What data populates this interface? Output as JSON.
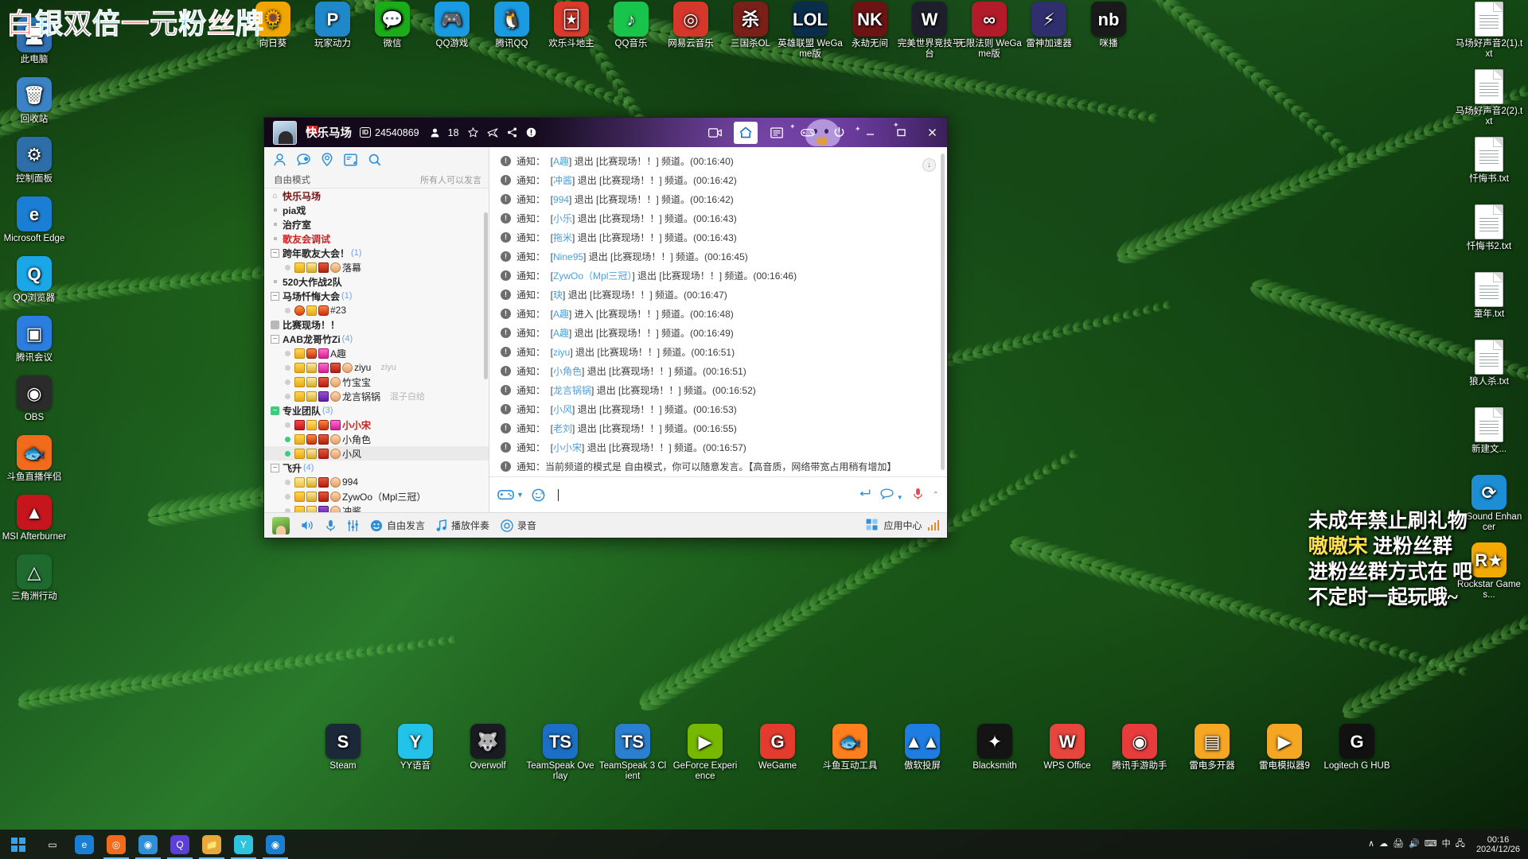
{
  "desktop": {
    "banner_text": [
      {
        "t": "白",
        "c": "#e8312a"
      },
      {
        "t": "银",
        "c": "#1fb3d6"
      },
      {
        "t": "双",
        "c": "#111111"
      },
      {
        "t": "倍",
        "c": "#1fb3d6"
      },
      {
        "t": "一",
        "c": "#e8312a"
      },
      {
        "t": "元",
        "c": "#111111"
      },
      {
        "t": "粉",
        "c": "#1fb3d6"
      },
      {
        "t": "丝",
        "c": "#e8312a"
      },
      {
        "t": "牌",
        "c": "#1fb3d6"
      }
    ],
    "watermark": [
      "未成年禁止刷礼物",
      "进粉丝群",
      "进粉丝群方式在 吧",
      "不定时一起玩哦~"
    ],
    "watermark_badge": "嗷嗷宋",
    "left_icons": [
      {
        "label": "此电脑",
        "icon": "computer-icon",
        "glyph": "🖥",
        "bg": "#2f6fb3"
      },
      {
        "label": "回收站",
        "icon": "recycle-bin-icon",
        "glyph": "🗑",
        "bg": "#3b82c4"
      },
      {
        "label": "控制面板",
        "icon": "control-panel-icon",
        "glyph": "⚙",
        "bg": "#2d6ea8"
      },
      {
        "label": "Microsoft Edge",
        "icon": "edge-icon",
        "glyph": "e",
        "bg": "#1a7fd4"
      },
      {
        "label": "QQ浏览器",
        "icon": "qq-browser-icon",
        "glyph": "Q",
        "bg": "#1aa7e8"
      },
      {
        "label": "腾讯会议",
        "icon": "tencent-meeting-icon",
        "glyph": "▣",
        "bg": "#2b7de0"
      },
      {
        "label": "OBS",
        "icon": "obs-icon",
        "glyph": "◉",
        "bg": "#2b2b2b"
      },
      {
        "label": "斗鱼直播伴侣",
        "icon": "douyu-companion-icon",
        "glyph": "🐟",
        "bg": "#f26a1b"
      },
      {
        "label": "MSI Afterburner",
        "icon": "msi-afterburner-icon",
        "glyph": "▲",
        "bg": "#c4161c"
      },
      {
        "label": "三角洲行动",
        "icon": "delta-force-icon",
        "glyph": "△",
        "bg": "#1f6b2f"
      }
    ],
    "top_icons": [
      {
        "label": "向日葵",
        "icon": "sunflower-icon",
        "glyph": "🌻",
        "bg": "#f0a500"
      },
      {
        "label": "玩家动力",
        "icon": "player-power-icon",
        "glyph": "P",
        "bg": "#1e88c8"
      },
      {
        "label": "微信",
        "icon": "wechat-icon",
        "glyph": "💬",
        "bg": "#1aad19"
      },
      {
        "label": "QQ游戏",
        "icon": "qq-games-icon",
        "glyph": "🎮",
        "bg": "#1a9ae0"
      },
      {
        "label": "腾讯QQ",
        "icon": "tencent-qq-icon",
        "glyph": "🐧",
        "bg": "#1a9ae0"
      },
      {
        "label": "欢乐斗地主",
        "icon": "ddz-icon",
        "glyph": "🃏",
        "bg": "#d93a2b"
      },
      {
        "label": "QQ音乐",
        "icon": "qq-music-icon",
        "glyph": "♪",
        "bg": "#18c44c"
      },
      {
        "label": "网易云音乐",
        "icon": "netease-music-icon",
        "glyph": "◎",
        "bg": "#d6372b"
      },
      {
        "label": "三国杀OL",
        "icon": "sgs-icon",
        "glyph": "杀",
        "bg": "#7a2018"
      },
      {
        "label": "英雄联盟 WeGame版",
        "icon": "lol-wegame-icon",
        "glyph": "LOL",
        "bg": "#0a2e4a"
      },
      {
        "label": "永劫无间",
        "icon": "naraka-icon",
        "glyph": "NK",
        "bg": "#6b1414"
      },
      {
        "label": "完美世界竞技平台",
        "icon": "perfect-world-icon",
        "glyph": "W",
        "bg": "#1e1e2c"
      },
      {
        "label": "无限法则 WeGame版",
        "icon": "ring-of-elysium-icon",
        "glyph": "∞",
        "bg": "#b21b2a"
      },
      {
        "label": "雷神加速器",
        "icon": "leishen-booster-icon",
        "glyph": "⚡",
        "bg": "#2f2f6e"
      },
      {
        "label": "咪播",
        "icon": "mibo-icon",
        "glyph": "nb",
        "bg": "#1a1a1a"
      }
    ],
    "right_icons": [
      {
        "label": "马场好声音2(1).txt",
        "icon": "text-file-icon"
      },
      {
        "label": "马场好声音2(2).txt",
        "icon": "text-file-icon"
      },
      {
        "label": "忏悔书.txt",
        "icon": "text-file-icon"
      },
      {
        "label": "忏悔书2.txt",
        "icon": "text-file-icon"
      },
      {
        "label": "童年.txt",
        "icon": "text-file-icon"
      },
      {
        "label": "狼人杀.txt",
        "icon": "text-file-icon"
      },
      {
        "label": "新建文...",
        "icon": "text-file-icon"
      },
      {
        "label": "FxSound Enhancer",
        "icon": "fxsound-icon",
        "glyph": "⟳",
        "bg": "#1b8ed6"
      },
      {
        "label": "Rockstar Games...",
        "icon": "rockstar-games-icon",
        "glyph": "R★",
        "bg": "#f2a900"
      }
    ],
    "dock_icons": [
      {
        "label": "Steam",
        "icon": "steam-icon",
        "glyph": "S",
        "bg": "#1b2838"
      },
      {
        "label": "YY语音",
        "icon": "yy-voice-icon",
        "glyph": "Y",
        "bg": "#23c2e8"
      },
      {
        "label": "Overwolf",
        "icon": "overwolf-icon",
        "glyph": "🐺",
        "bg": "#1a1a22"
      },
      {
        "label": "TeamSpeak Overlay",
        "icon": "teamspeak-overlay-icon",
        "glyph": "TS",
        "bg": "#1b6fc4"
      },
      {
        "label": "TeamSpeak 3 Client",
        "icon": "teamspeak3-icon",
        "glyph": "TS",
        "bg": "#2a7fd0"
      },
      {
        "label": "GeForce Experience",
        "icon": "geforce-experience-icon",
        "glyph": "▶",
        "bg": "#76b900"
      },
      {
        "label": "WeGame",
        "icon": "wegame-icon",
        "glyph": "G",
        "bg": "#e33c2e"
      },
      {
        "label": "斗鱼互动工具",
        "icon": "douyu-tool-icon",
        "glyph": "🐟",
        "bg": "#ff7f1e"
      },
      {
        "label": "傲软投屏",
        "icon": "apowermirror-icon",
        "glyph": "▲▲",
        "bg": "#1e7de0"
      },
      {
        "label": "Blacksmith",
        "icon": "blacksmith-icon",
        "glyph": "✦",
        "bg": "#141414"
      },
      {
        "label": "WPS Office",
        "icon": "wps-office-icon",
        "glyph": "W",
        "bg": "#e8463c"
      },
      {
        "label": "腾讯手游助手",
        "icon": "tencent-gameloop-icon",
        "glyph": "◉",
        "bg": "#e83c3c"
      },
      {
        "label": "雷电多开器",
        "icon": "ldmultiplayer-icon",
        "glyph": "▤",
        "bg": "#f5a623"
      },
      {
        "label": "雷电模拟器9",
        "icon": "ldplayer9-icon",
        "glyph": "▶",
        "bg": "#f5a623"
      },
      {
        "label": "Logitech G HUB",
        "icon": "logitech-ghub-icon",
        "glyph": "G",
        "bg": "#111111"
      }
    ],
    "taskbar": {
      "start_label": "start-button",
      "items": [
        {
          "icon": "task-view-icon",
          "glyph": "▭",
          "bg": "transparent"
        },
        {
          "icon": "edge-icon",
          "glyph": "e",
          "bg": "#1a7fd4"
        },
        {
          "icon": "douyu-icon",
          "glyph": "◎",
          "bg": "#f26a1b"
        },
        {
          "icon": "chrome-icon",
          "glyph": "◉",
          "bg": "#2f8fd8"
        },
        {
          "icon": "qq-browser-icon",
          "glyph": "Q",
          "bg": "#5b3fd6"
        },
        {
          "icon": "explorer-icon",
          "glyph": "📁",
          "bg": "#e8a83c"
        },
        {
          "icon": "yy-voice-icon",
          "glyph": "Y",
          "bg": "#2ec4de"
        },
        {
          "icon": "obs-icon",
          "glyph": "◉",
          "bg": "#1b7fd0"
        }
      ],
      "tray_glyphs": [
        "∧",
        "☁",
        "🖨",
        "🔊",
        "⌨",
        "中",
        "🖧"
      ],
      "clock_time": "00:16",
      "clock_date": "2024/12/26"
    }
  },
  "yy": {
    "title": {
      "channel_name": "快乐马场",
      "id_chip": "ID",
      "channel_id": "24540869",
      "online_icon": "person-icon",
      "online_count": "18",
      "star_icon": "star-icon",
      "plane_icon": "plane-icon",
      "share_icon": "share-icon",
      "info_icon": "info-icon",
      "video_icon": "video-camera-icon",
      "home_icon": "home-icon",
      "list_icon": "list-icon",
      "game_icon": "gamepad-icon",
      "power_icon": "power-icon",
      "minimize_icon": "minimize-icon",
      "maximize_icon": "maximize-icon",
      "close_icon": "close-icon"
    },
    "left": {
      "tool_icons": [
        "person-icon",
        "chat-icon",
        "location-pin-icon",
        "message-board-icon",
        "search-icon"
      ],
      "mode_label": "自由模式",
      "mode_right_label": "所有人可以发言",
      "tree": [
        {
          "type": "channel",
          "toggle": "home",
          "label": "快乐马场",
          "style": "root",
          "count": ""
        },
        {
          "type": "channel",
          "toggle": "dot",
          "label": "pia戏",
          "count": ""
        },
        {
          "type": "channel",
          "toggle": "dot",
          "label": "治疗室",
          "count": ""
        },
        {
          "type": "channel",
          "toggle": "dot",
          "label": "歌友会调试",
          "style": "red",
          "count": ""
        },
        {
          "type": "channel",
          "toggle": "box",
          "label": "跨年歌友大会！",
          "count": "(1)"
        },
        {
          "type": "user",
          "status": "off",
          "name": "落幕",
          "badges": [
            "gift",
            "crown",
            "fortune",
            "egg"
          ],
          "sig": ""
        },
        {
          "type": "channel",
          "toggle": "dot",
          "label": "520大作战2队",
          "count": ""
        },
        {
          "type": "channel",
          "toggle": "box",
          "label": "马场忏悔大会",
          "count": "(1)"
        },
        {
          "type": "user",
          "status": "off",
          "name": "#23",
          "badges": [
            "medal",
            "gift",
            "crown2"
          ],
          "sig": ""
        },
        {
          "type": "channel",
          "toggle": "lock",
          "label": "比赛现场！！",
          "count": ""
        },
        {
          "type": "channel",
          "toggle": "box",
          "label": "AAB龙哥竹Zi",
          "count": "(4)"
        },
        {
          "type": "user",
          "status": "off",
          "name": "A趣",
          "badges": [
            "gift",
            "crown2",
            "diamond"
          ],
          "sig": ""
        },
        {
          "type": "user",
          "status": "off",
          "name": "ziyu",
          "badges": [
            "gift",
            "crown",
            "diamond",
            "fortune",
            "egg"
          ],
          "sig": "ziyu"
        },
        {
          "type": "user",
          "status": "off",
          "name": "竹宝宝",
          "badges": [
            "gift",
            "crown",
            "fortune",
            "egg"
          ],
          "sig": ""
        },
        {
          "type": "user",
          "status": "off",
          "name": "龙言锅锅",
          "badges": [
            "gift",
            "crown",
            "purple",
            "egg"
          ],
          "sig": "混子白给"
        },
        {
          "type": "channel",
          "toggle": "green",
          "label": "专业团队",
          "count": "(3)"
        },
        {
          "type": "user",
          "status": "off",
          "name": "小小宋",
          "badges": [
            "v",
            "gift2",
            "crown2",
            "diamond"
          ],
          "style": "red",
          "sig": ""
        },
        {
          "type": "user",
          "status": "on",
          "name": "小角色",
          "badges": [
            "gift",
            "crown2",
            "fortune",
            "egg"
          ],
          "sig": ""
        },
        {
          "type": "user",
          "status": "on",
          "name": "小风",
          "badges": [
            "gift",
            "crown",
            "fortune",
            "egg"
          ],
          "sig": "",
          "selected": true
        },
        {
          "type": "channel",
          "toggle": "box",
          "label": "飞升",
          "count": "(4)"
        },
        {
          "type": "user",
          "status": "off",
          "name": "994",
          "badges": [
            "gift3",
            "crown",
            "fortune",
            "egg"
          ],
          "sig": ""
        },
        {
          "type": "user",
          "status": "off",
          "name": "ZywOo（Mpl三冠）",
          "badges": [
            "gift",
            "crown",
            "fortune",
            "egg"
          ],
          "sig": ""
        },
        {
          "type": "user",
          "status": "off",
          "name": "冲酱",
          "badges": [
            "gift",
            "crown",
            "purple",
            "egg"
          ],
          "sig": ""
        }
      ]
    },
    "messages": [
      {
        "prefix": "通知：",
        "user": "A趣",
        "action": "退出",
        "channel": "比赛现场！！",
        "suffix": "频道。",
        "time": "(00:16:40)"
      },
      {
        "prefix": "通知：",
        "user": "冲酱",
        "action": "退出",
        "channel": "比赛现场！！",
        "suffix": "频道。",
        "time": "(00:16:42)"
      },
      {
        "prefix": "通知：",
        "user": "994",
        "action": "退出",
        "channel": "比赛现场！！",
        "suffix": "频道。",
        "time": "(00:16:42)"
      },
      {
        "prefix": "通知：",
        "user": "小乐",
        "action": "退出",
        "channel": "比赛现场！！",
        "suffix": "频道。",
        "time": "(00:16:43)"
      },
      {
        "prefix": "通知：",
        "user": "拖米",
        "action": "退出",
        "channel": "比赛现场！！",
        "suffix": "频道。",
        "time": "(00:16:43)"
      },
      {
        "prefix": "通知：",
        "user": "Nine95",
        "action": "退出",
        "channel": "比赛现场！！",
        "suffix": "频道。",
        "time": "(00:16:45)"
      },
      {
        "prefix": "通知：",
        "user": "ZywOo（Mpl三冠）",
        "action": "退出",
        "channel": "比赛现场！！",
        "suffix": "频道。",
        "time": "(00:16:46)"
      },
      {
        "prefix": "通知：",
        "user": "玦",
        "action": "退出",
        "channel": "比赛现场！！",
        "suffix": "频道。",
        "time": "(00:16:47)"
      },
      {
        "prefix": "通知：",
        "user": "A趣",
        "action": "进入",
        "channel": "比赛现场！！",
        "suffix": "频道。",
        "time": "(00:16:48)"
      },
      {
        "prefix": "通知：",
        "user": "A趣",
        "action": "退出",
        "channel": "比赛现场！！",
        "suffix": "频道。",
        "time": "(00:16:49)"
      },
      {
        "prefix": "通知：",
        "user": "ziyu",
        "action": "退出",
        "channel": "比赛现场！！",
        "suffix": "频道。",
        "time": "(00:16:51)"
      },
      {
        "prefix": "通知：",
        "user": "小角色",
        "action": "退出",
        "channel": "比赛现场！！",
        "suffix": "频道。",
        "time": "(00:16:51)"
      },
      {
        "prefix": "通知：",
        "user": "龙言锅锅",
        "action": "退出",
        "channel": "比赛现场！！",
        "suffix": "频道。",
        "time": "(00:16:52)"
      },
      {
        "prefix": "通知：",
        "user": "小风",
        "action": "退出",
        "channel": "比赛现场！！",
        "suffix": "频道。",
        "time": "(00:16:53)"
      },
      {
        "prefix": "通知：",
        "user": "老刘",
        "action": "退出",
        "channel": "比赛现场！！",
        "suffix": "频道。",
        "time": "(00:16:55)"
      },
      {
        "prefix": "通知：",
        "user": "小小宋",
        "action": "退出",
        "channel": "比赛现场！！",
        "suffix": "频道。",
        "time": "(00:16:57)"
      }
    ],
    "last_message": "通知：当前频道的模式是 自由模式，你可以随意发言。【高音质，网络带宽占用稍有增加】",
    "input": {
      "emoji_icon": "game-emoji-icon",
      "dropdown_icon": "chevron-down-icon",
      "face_icon": "face-icon",
      "value": "",
      "enter_icon": "enter-icon",
      "bubble_icon": "speech-bubble-icon",
      "mic_icon": "microphone-icon",
      "collapse_icon": "chevron-up-icon"
    },
    "bottom": {
      "avatar_icon": "user-avatar",
      "speaker_icon": "speaker-icon",
      "mic_icon": "microphone-icon",
      "equalizer_icon": "equalizer-icon",
      "smile_icon": "smiley-icon",
      "free_speak_label": "自由发言",
      "music_icon": "music-note-icon",
      "accompaniment_label": "播放伴奏",
      "record_icon": "record-icon",
      "record_label": "录音",
      "app_center_icon": "apps-grid-icon",
      "app_center_label": "应用中心",
      "signal_icon": "signal-bars-icon"
    }
  }
}
